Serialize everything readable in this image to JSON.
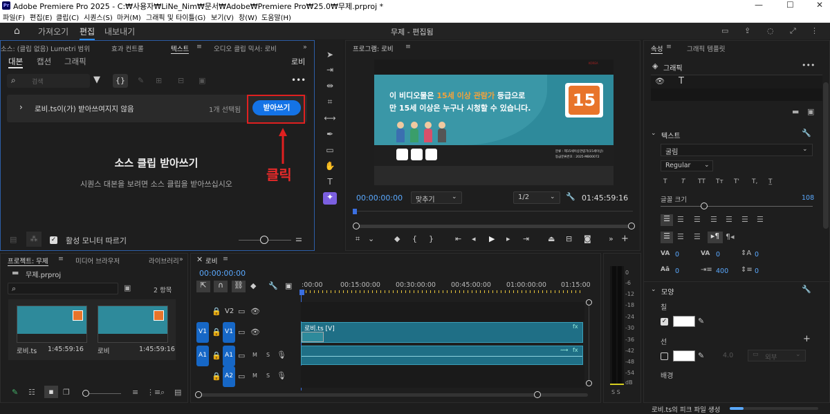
{
  "window": {
    "title": "Adobe Premiere Pro 2025 - C:₩사용자₩LiNe_Nim₩문서₩Adobe₩Premiere Pro₩25.0₩무제.prproj *",
    "logo": "Pr",
    "minimize": "—",
    "maximize": "☐",
    "close": "✕"
  },
  "menu": [
    "파일(F)",
    "편집(E)",
    "클립(C)",
    "시퀀스(S)",
    "마커(M)",
    "그래픽 및 타이틀(G)",
    "보기(V)",
    "창(W)",
    "도움말(H)"
  ],
  "workspace": {
    "tabs": [
      "가져오기",
      "편집",
      "내보내기"
    ],
    "active": "편집",
    "title": "무제 - 편집됨"
  },
  "source_panel": {
    "tabs": [
      "소스: (클립 없음)",
      "Lumetri 범위",
      "효과 컨트롤",
      "텍스트",
      "오디오 클립 믹서: 로비"
    ],
    "sub_tabs": [
      "대본",
      "캡션",
      "그래픽"
    ],
    "sequence": "로비",
    "search_placeholder": "검색",
    "notice": "로비.ts이(가) 받아쓰여지지 않음",
    "selected": "1개 선택됨",
    "transcribe_btn": "받아쓰기",
    "heading": "소스 클립 받아쓰기",
    "desc": "시퀀스 대본을 보려면 소스 클립을 받아쓰십시오",
    "follow_label": "활성 모니터 따르기",
    "annotation": "클릭"
  },
  "program": {
    "title": "프로그램: 로비",
    "timecode": "00:00:00:00",
    "fit": "맞추기",
    "res": "1/2",
    "duration": "01:45:59:16",
    "video": {
      "line1a": "이 비디오물은 ",
      "line1b": "15세 이상 관람가",
      "line1c": " 등급으로",
      "line2": "만 15세 이상은 누구나 시청할 수 있습니다.",
      "badge": "15",
      "small1": "분류 : 제15세이상관람가(15세이상)",
      "small2": "등급분류번호 : 2025-MB00072",
      "brand": "KOREA"
    }
  },
  "properties": {
    "tabs": [
      "속성",
      "그래픽 템플릿"
    ],
    "graphic": "그래픽",
    "text_section": "텍스트",
    "font": "굴림",
    "style": "Regular",
    "text_styles": [
      "T",
      "T",
      "TT",
      "Tт",
      "T'",
      "T,",
      "T̲"
    ],
    "font_size_label": "글꼴 크기",
    "font_size": "108",
    "tracking_values": [
      "0",
      "0",
      "0",
      "0",
      "400",
      "0"
    ],
    "shape_section": "모양",
    "fill": "칠",
    "stroke": "선",
    "stroke_width": "4.0",
    "stroke_pos": "외부",
    "background": "배경"
  },
  "project": {
    "tabs": [
      "프로젝트: 무제",
      "미디어 브라우저",
      "라이브러리"
    ],
    "file": "무제.prproj",
    "count": "2 항목",
    "items": [
      {
        "name": "로비.ts",
        "dur": "1:45:59:16"
      },
      {
        "name": "로비",
        "dur": "1:45:59:16"
      }
    ]
  },
  "timeline": {
    "tab": "로비",
    "timecode": "00:00:00:00",
    "ruler": [
      ":00:00",
      "00:15:00:00",
      "00:30:00:00",
      "00:45:00:00",
      "01:00:00:00",
      "01:15:00"
    ],
    "tracks": [
      {
        "src": "",
        "id": "V2",
        "kind": "v"
      },
      {
        "src": "V1",
        "id": "V1",
        "kind": "v"
      },
      {
        "src": "A1",
        "id": "A1",
        "kind": "a"
      },
      {
        "src": "",
        "id": "A2",
        "kind": "a"
      }
    ],
    "clip": "로비.ts [V]",
    "fx": "fx"
  },
  "meter": {
    "ticks": [
      "0",
      "-6",
      "-12",
      "-18",
      "-24",
      "-30",
      "-36",
      "-42",
      "-48",
      "-54",
      "dB"
    ],
    "solo": "S S"
  },
  "status": {
    "text": "로비.ts의 피크 파일 생성"
  },
  "colors": {
    "accent": "#1473e6",
    "annotation": "#e02020",
    "teal": "#2e8a9b",
    "orange": "#e8742a"
  }
}
